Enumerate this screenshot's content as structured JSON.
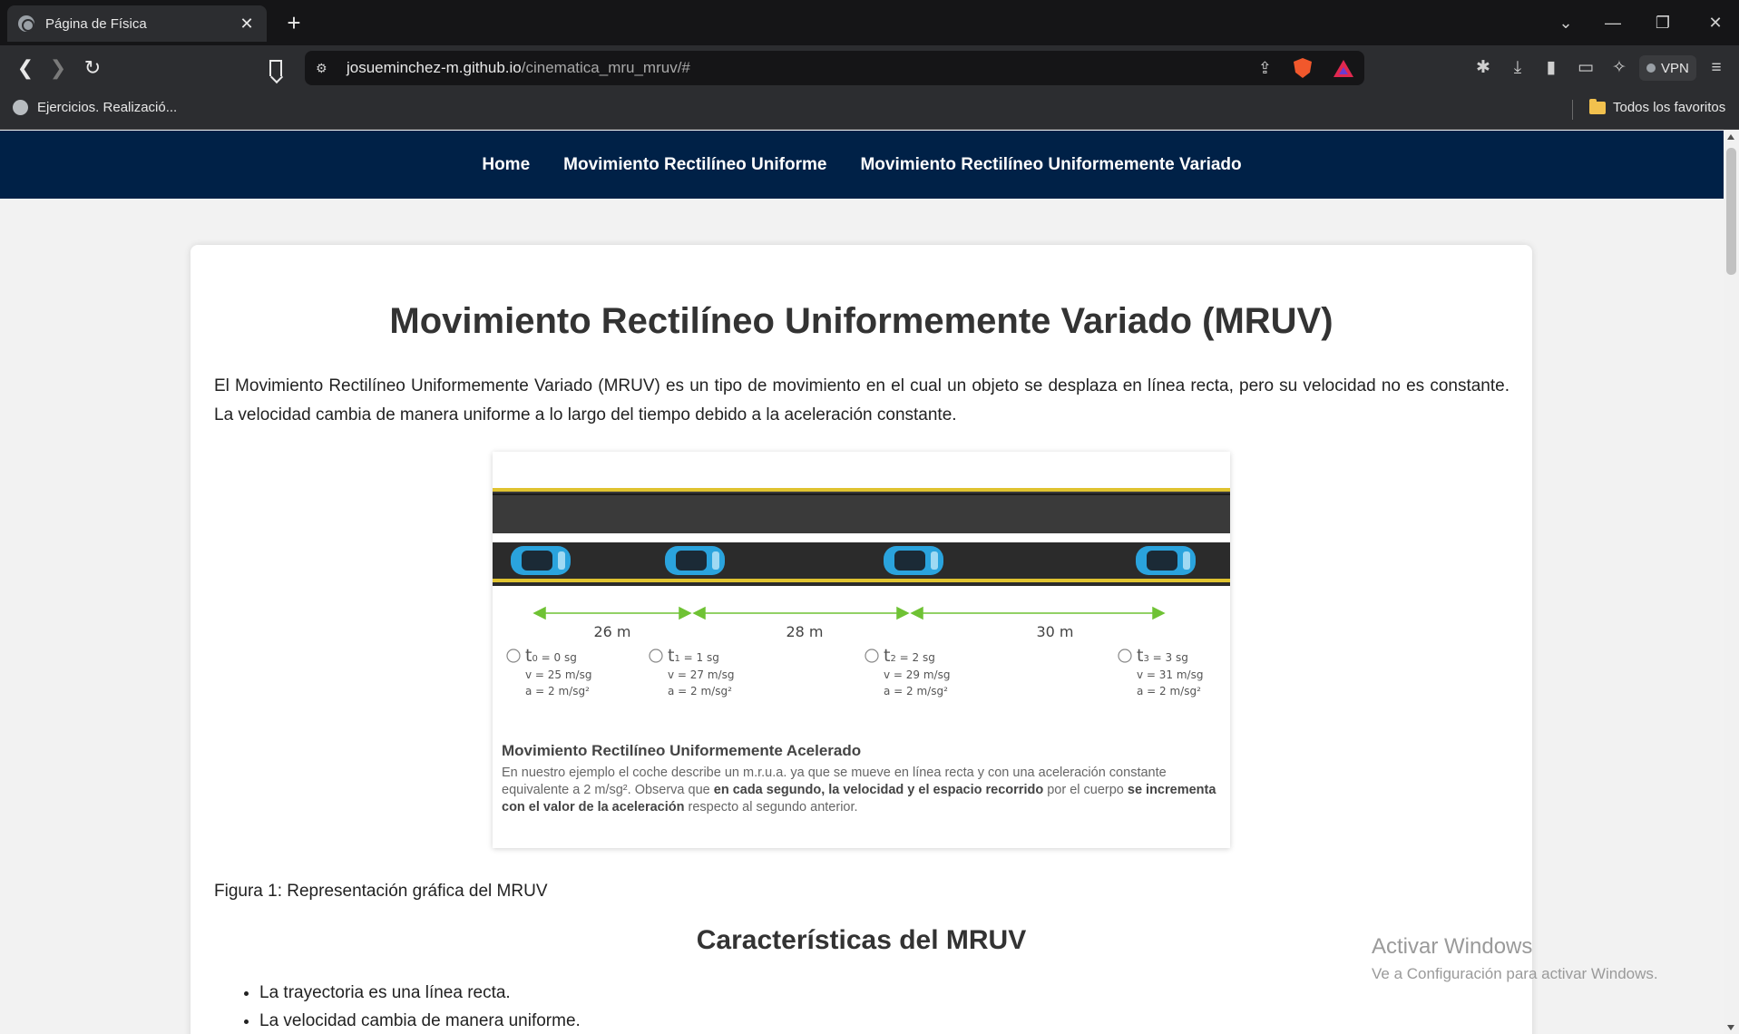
{
  "browser": {
    "tab_title": "Página de Física",
    "tab_close": "✕",
    "new_tab": "+",
    "url_domain": "josueminchez-m.github.io",
    "url_path": "/cinematica_mru_mruv/#",
    "vpn_label": "VPN",
    "bookmark_item": "Ejercicios. Realizació...",
    "all_bookmarks": "Todos los favoritos"
  },
  "nav": {
    "home": "Home",
    "mru": "Movimiento Rectilíneo Uniforme",
    "mruv": "Movimiento Rectilíneo Uniformemente Variado"
  },
  "page": {
    "title": "Movimiento Rectilíneo Uniformemente Variado (MRUV)",
    "intro": "El Movimiento Rectilíneo Uniformemente Variado (MRUV) es un tipo de movimiento en el cual un objeto se desplaza en línea recta, pero su velocidad no es constante. La velocidad cambia de manera uniforme a lo largo del tiempo debido a la aceleración constante.",
    "figure_label": "Figura 1: Representación gráfica del MRUV",
    "section_title": "Características del MRUV",
    "features": [
      "La trayectoria es una línea recta.",
      "La velocidad cambia de manera uniforme."
    ]
  },
  "figure": {
    "distances": [
      "26 m",
      "28 m",
      "30 m"
    ],
    "states": [
      {
        "t": "t",
        "sub": "0",
        "t_val": " = 0 sg",
        "v": "v = 25 m/sg",
        "a": "a = 2 m/sg²"
      },
      {
        "t": "t",
        "sub": "1",
        "t_val": " = 1 sg",
        "v": "v = 27 m/sg",
        "a": "a = 2 m/sg²"
      },
      {
        "t": "t",
        "sub": "2",
        "t_val": " = 2 sg",
        "v": "v = 29 m/sg",
        "a": "a = 2 m/sg²"
      },
      {
        "t": "t",
        "sub": "3",
        "t_val": " = 3 sg",
        "v": "v = 31 m/sg",
        "a": "a = 2 m/sg²"
      }
    ],
    "caption_title": "Movimiento Rectilíneo Uniformemente Acelerado",
    "caption_1": "En nuestro ejemplo el coche describe un m.r.u.a. ya que se mueve en línea recta y con una aceleración constante equivalente a 2 m/sg². Observa que ",
    "caption_bold_1": "en cada segundo, la velocidad y el espacio recorrido",
    "caption_2": " por el cuerpo ",
    "caption_bold_2": "se incrementa con el valor de la aceleración",
    "caption_3": " respecto al segundo anterior.",
    "arrow_color": "#6fc234",
    "car_color": "#2aa3dd"
  },
  "watermark": {
    "line1": "Activar Windows",
    "line2": "Ve a Configuración para activar Windows."
  }
}
